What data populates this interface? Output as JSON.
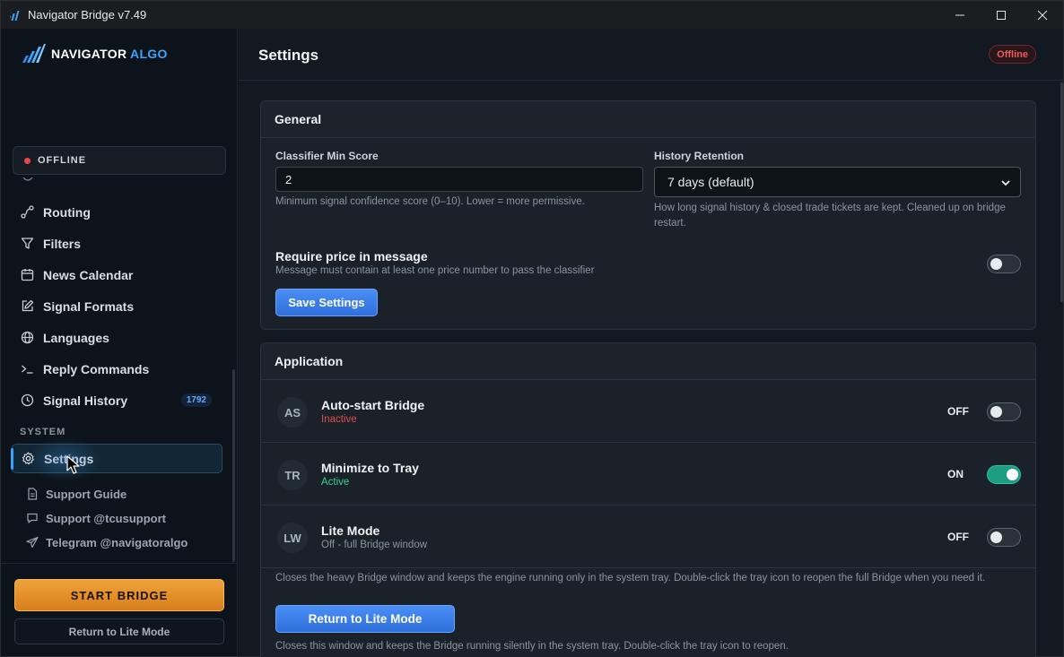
{
  "window": {
    "title": "Navigator Bridge v7.49"
  },
  "logo": {
    "text_main": "NAVIGATOR",
    "text_accent": "ALGO"
  },
  "status": {
    "label": "OFFLINE",
    "color": "#ea4646"
  },
  "nav": {
    "items": [
      {
        "label": "Routing",
        "icon": "route-icon"
      },
      {
        "label": "Filters",
        "icon": "filter-icon"
      },
      {
        "label": "News Calendar",
        "icon": "calendar-icon"
      },
      {
        "label": "Signal Formats",
        "icon": "edit-icon"
      },
      {
        "label": "Languages",
        "icon": "globe-icon"
      },
      {
        "label": "Reply Commands",
        "icon": "terminal-icon"
      },
      {
        "label": "Signal History",
        "icon": "clock-icon",
        "badge": "1792"
      }
    ],
    "system_label": "SYSTEM",
    "settings_label": "Settings",
    "sub_items": [
      {
        "label": "Support Guide",
        "icon": "document-icon"
      },
      {
        "label": "Support @tcusupport",
        "icon": "chat-icon"
      },
      {
        "label": "Telegram @navigatoralgo",
        "icon": "send-icon"
      }
    ]
  },
  "footer": {
    "start_label": "START BRIDGE",
    "lite_label": "Return to Lite Mode"
  },
  "header": {
    "title": "Settings",
    "status_pill": "Offline"
  },
  "general": {
    "title": "General",
    "classifier_label": "Classifier Min Score",
    "classifier_value": "2",
    "classifier_help": "Minimum signal confidence score (0–10). Lower = more permissive.",
    "history_label": "History Retention",
    "history_value": "7 days (default)",
    "history_help": "How long signal history & closed trade tickets are kept. Cleaned up on bridge restart.",
    "require_price_title": "Require price in message",
    "require_price_help": "Message must contain at least one price number to pass the classifier",
    "require_price_on": false,
    "save_label": "Save Settings"
  },
  "application": {
    "title": "Application",
    "rows": [
      {
        "abbr": "AS",
        "title": "Auto-start Bridge",
        "subtitle": "Inactive",
        "subtitle_color": "#e24b4b",
        "state": "OFF",
        "on": false
      },
      {
        "abbr": "TR",
        "title": "Minimize to Tray",
        "subtitle": "Active",
        "subtitle_color": "#3ccf8e",
        "state": "ON",
        "on": true
      },
      {
        "abbr": "LW",
        "title": "Lite Mode",
        "subtitle": "Off - full Bridge window",
        "subtitle_color": "#8995a2",
        "state": "OFF",
        "on": false
      }
    ],
    "lite_desc": "Closes the heavy Bridge window and keeps the engine running only in the system tray. Double-click the tray icon to reopen the full Bridge when you need it.",
    "lite_button": "Return to Lite Mode",
    "tray_desc": "Closes this window and keeps the Bridge running silently in the system tray. Double-click the tray icon to reopen."
  }
}
